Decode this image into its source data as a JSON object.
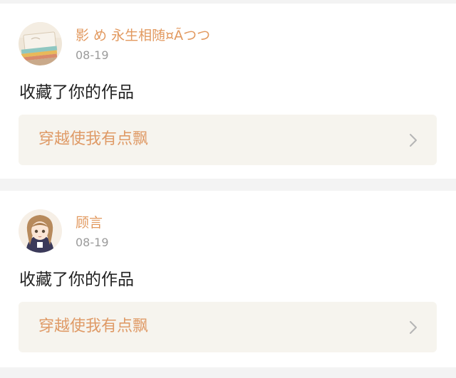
{
  "notifications": [
    {
      "username": "影 め 永生相随¤Ãつつ",
      "date": "08-19",
      "action": "收藏了你的作品",
      "work_title": "穿越使我有点飘",
      "avatar_icon": "notebook-photo-avatar"
    },
    {
      "username": "顾言",
      "date": "08-19",
      "action": "收藏了你的作品",
      "work_title": "穿越使我有点飘",
      "avatar_icon": "anime-girl-avatar"
    }
  ],
  "colors": {
    "username": "#e2995f",
    "work_title": "#df9a66",
    "work_link_bg": "#f6f4ee",
    "date": "#9b9b9b",
    "page_bg": "#f3f3f3"
  }
}
